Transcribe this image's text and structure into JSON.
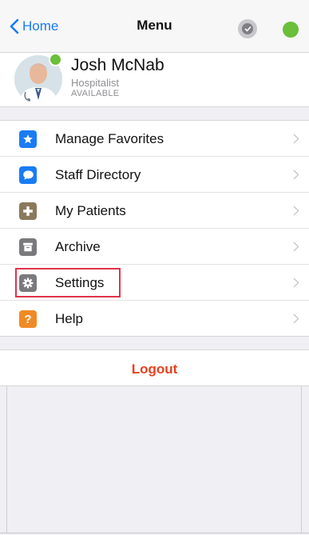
{
  "navbar": {
    "back_label": "Home",
    "title": "Menu",
    "presence_color": "#6bbf3a"
  },
  "profile": {
    "name": "Josh McNab",
    "role": "Hospitalist",
    "status": "AVAILABLE",
    "status_color": "#6bbf3a"
  },
  "menu": {
    "items": [
      {
        "label": "Manage Favorites",
        "icon": "star-icon",
        "color": "#1a7cf4"
      },
      {
        "label": "Staff Directory",
        "icon": "chat-bubble-icon",
        "color": "#1a7cf4"
      },
      {
        "label": "My Patients",
        "icon": "medical-cross-icon",
        "color": "#8a7a5c"
      },
      {
        "label": "Archive",
        "icon": "archive-box-icon",
        "color": "#7a7a7e"
      },
      {
        "label": "Settings",
        "icon": "gear-icon",
        "color": "#7a7a7e"
      },
      {
        "label": "Help",
        "icon": "question-icon",
        "color": "#f08a24"
      }
    ]
  },
  "logout_label": "Logout",
  "colors": {
    "accent": "#1a7cf4",
    "destructive": "#e8401f",
    "highlight": "#e0334a"
  }
}
